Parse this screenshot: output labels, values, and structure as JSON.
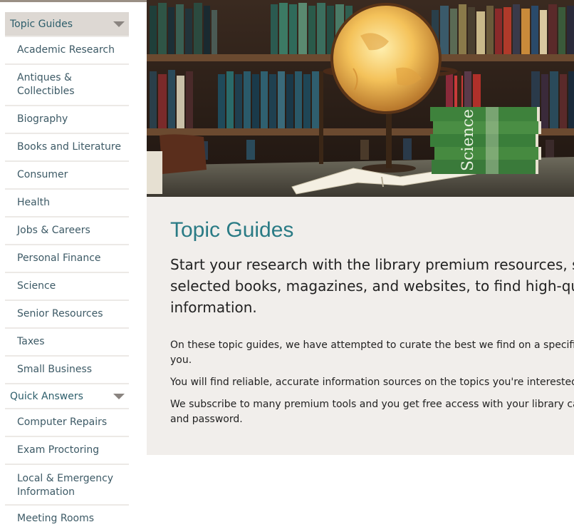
{
  "sidebar": {
    "topic_guides": {
      "label": "Topic Guides",
      "items": [
        {
          "label": "Academic Research"
        },
        {
          "label": "Antiques & Collectibles"
        },
        {
          "label": "Biography"
        },
        {
          "label": "Books and Literature"
        },
        {
          "label": "Consumer"
        },
        {
          "label": "Health"
        },
        {
          "label": "Jobs & Careers"
        },
        {
          "label": "Personal Finance"
        },
        {
          "label": "Science"
        },
        {
          "label": "Senior Resources"
        },
        {
          "label": "Taxes"
        },
        {
          "label": "Small Business"
        }
      ]
    },
    "quick_answers": {
      "label": "Quick Answers",
      "items": [
        {
          "label": "Computer Repairs"
        },
        {
          "label": "Exam Proctoring"
        },
        {
          "label": "Local & Emergency",
          "label_line2": "Information"
        },
        {
          "label": "Meeting Rooms"
        }
      ]
    }
  },
  "hero": {
    "book_spine_text": "Science"
  },
  "main": {
    "title": "Topic Guides",
    "intro_lines": [
      "Start your research with the library premium resources, staff-",
      "selected books, magazines, and websites, to find high-quality",
      "information."
    ],
    "paragraphs": [
      {
        "line1": "On these topic guides, we have attempted to curate the best we find on a specific topic",
        "line2": "you."
      },
      {
        "line1": "You will find reliable, accurate information sources on the topics you're interested in."
      },
      {
        "line1": "We subscribe to many premium tools and you get free access with your library card nur",
        "line2": "and password."
      }
    ]
  },
  "colors": {
    "accent_title": "#2a7b85",
    "sidebar_text": "#3d5a66",
    "content_bg": "#f1eeeb",
    "active_section_bg": "#ddd8d3"
  }
}
